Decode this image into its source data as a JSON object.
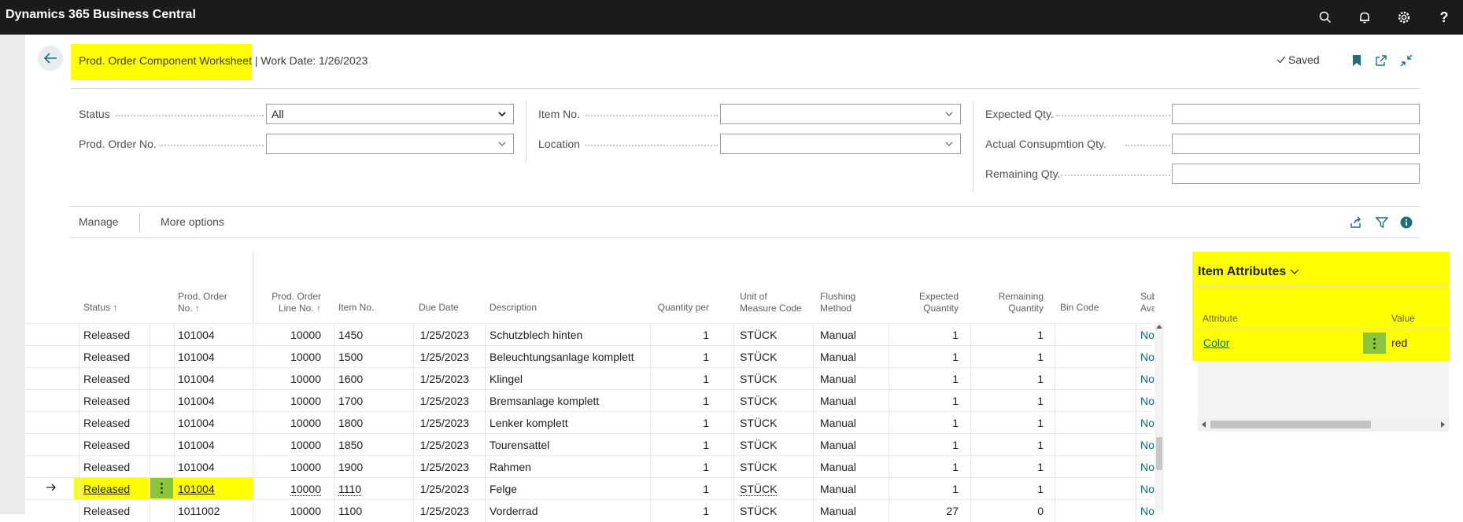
{
  "app": {
    "title": "Dynamics 365 Business Central"
  },
  "header": {
    "title": "Prod. Order Component Worksheet",
    "work_date": "| Work Date: 1/26/2023",
    "saved": "Saved"
  },
  "filters": {
    "status": {
      "label": "Status",
      "value": "All"
    },
    "prod_order_no": {
      "label": "Prod. Order No.",
      "value": ""
    },
    "item_no": {
      "label": "Item No.",
      "value": ""
    },
    "location": {
      "label": "Location",
      "value": ""
    },
    "expected_qty": {
      "label": "Expected Qty.",
      "value": ""
    },
    "actual_consumption": {
      "label": "Actual Consupmtion Qty.",
      "value": ""
    },
    "remaining_qty": {
      "label": "Remaining Qty.",
      "value": ""
    }
  },
  "actions": {
    "manage": "Manage",
    "more": "More options"
  },
  "grid": {
    "headers": {
      "status": "Status ↑",
      "prod_order_no_1": "Prod. Order",
      "prod_order_no_2": "No. ↑",
      "line_no_1": "Prod. Order",
      "line_no_2": "Line No. ↑",
      "item_no": "Item No.",
      "due_date": "Due Date",
      "description": "Description",
      "qty_per": "Quantity per",
      "uom_1": "Unit of",
      "uom_2": "Measure Code",
      "flushing_1": "Flushing",
      "flushing_2": "Method",
      "expected_1": "Expected",
      "expected_2": "Quantity",
      "remaining_1": "Remaining",
      "remaining_2": "Quantity",
      "bin": "Bin Code",
      "subst_1": "Substi",
      "subst_2": "Availa"
    },
    "rows": [
      {
        "status": "Released",
        "order": "101004",
        "line": "10000",
        "item": "1450",
        "due": "1/25/2023",
        "desc": "Schutzblech hinten",
        "qty_per": "1",
        "uom": "STÜCK",
        "flush": "Manual",
        "expected": "1",
        "remaining": "1",
        "bin": "",
        "subst": "No"
      },
      {
        "status": "Released",
        "order": "101004",
        "line": "10000",
        "item": "1500",
        "due": "1/25/2023",
        "desc": "Beleuchtungsanlage komplett",
        "qty_per": "1",
        "uom": "STÜCK",
        "flush": "Manual",
        "expected": "1",
        "remaining": "1",
        "bin": "",
        "subst": "No"
      },
      {
        "status": "Released",
        "order": "101004",
        "line": "10000",
        "item": "1600",
        "due": "1/25/2023",
        "desc": "Klingel",
        "qty_per": "1",
        "uom": "STÜCK",
        "flush": "Manual",
        "expected": "1",
        "remaining": "1",
        "bin": "",
        "subst": "No"
      },
      {
        "status": "Released",
        "order": "101004",
        "line": "10000",
        "item": "1700",
        "due": "1/25/2023",
        "desc": "Bremsanlage komplett",
        "qty_per": "1",
        "uom": "STÜCK",
        "flush": "Manual",
        "expected": "1",
        "remaining": "1",
        "bin": "",
        "subst": "No"
      },
      {
        "status": "Released",
        "order": "101004",
        "line": "10000",
        "item": "1800",
        "due": "1/25/2023",
        "desc": "Lenker komplett",
        "qty_per": "1",
        "uom": "STÜCK",
        "flush": "Manual",
        "expected": "1",
        "remaining": "1",
        "bin": "",
        "subst": "No"
      },
      {
        "status": "Released",
        "order": "101004",
        "line": "10000",
        "item": "1850",
        "due": "1/25/2023",
        "desc": "Tourensattel",
        "qty_per": "1",
        "uom": "STÜCK",
        "flush": "Manual",
        "expected": "1",
        "remaining": "1",
        "bin": "",
        "subst": "No"
      },
      {
        "status": "Released",
        "order": "101004",
        "line": "10000",
        "item": "1900",
        "due": "1/25/2023",
        "desc": "Rahmen",
        "qty_per": "1",
        "uom": "STÜCK",
        "flush": "Manual",
        "expected": "1",
        "remaining": "1",
        "bin": "",
        "subst": "No"
      },
      {
        "status": "Released",
        "order": "101004",
        "line": "10000",
        "item": "1110",
        "due": "1/25/2023",
        "desc": "Felge",
        "qty_per": "1",
        "uom": "STÜCK",
        "flush": "Manual",
        "expected": "1",
        "remaining": "1",
        "bin": "",
        "subst": "No"
      },
      {
        "status": "Released",
        "order": "1011002",
        "line": "10000",
        "item": "1100",
        "due": "1/25/2023",
        "desc": "Vorderrad",
        "qty_per": "1",
        "uom": "STÜCK",
        "flush": "Manual",
        "expected": "27",
        "remaining": "0",
        "bin": "",
        "subst": "No"
      }
    ]
  },
  "factbox": {
    "title": "Item Attributes",
    "col_attribute": "Attribute",
    "col_value": "Value",
    "attribute": "Color",
    "value": "red"
  }
}
